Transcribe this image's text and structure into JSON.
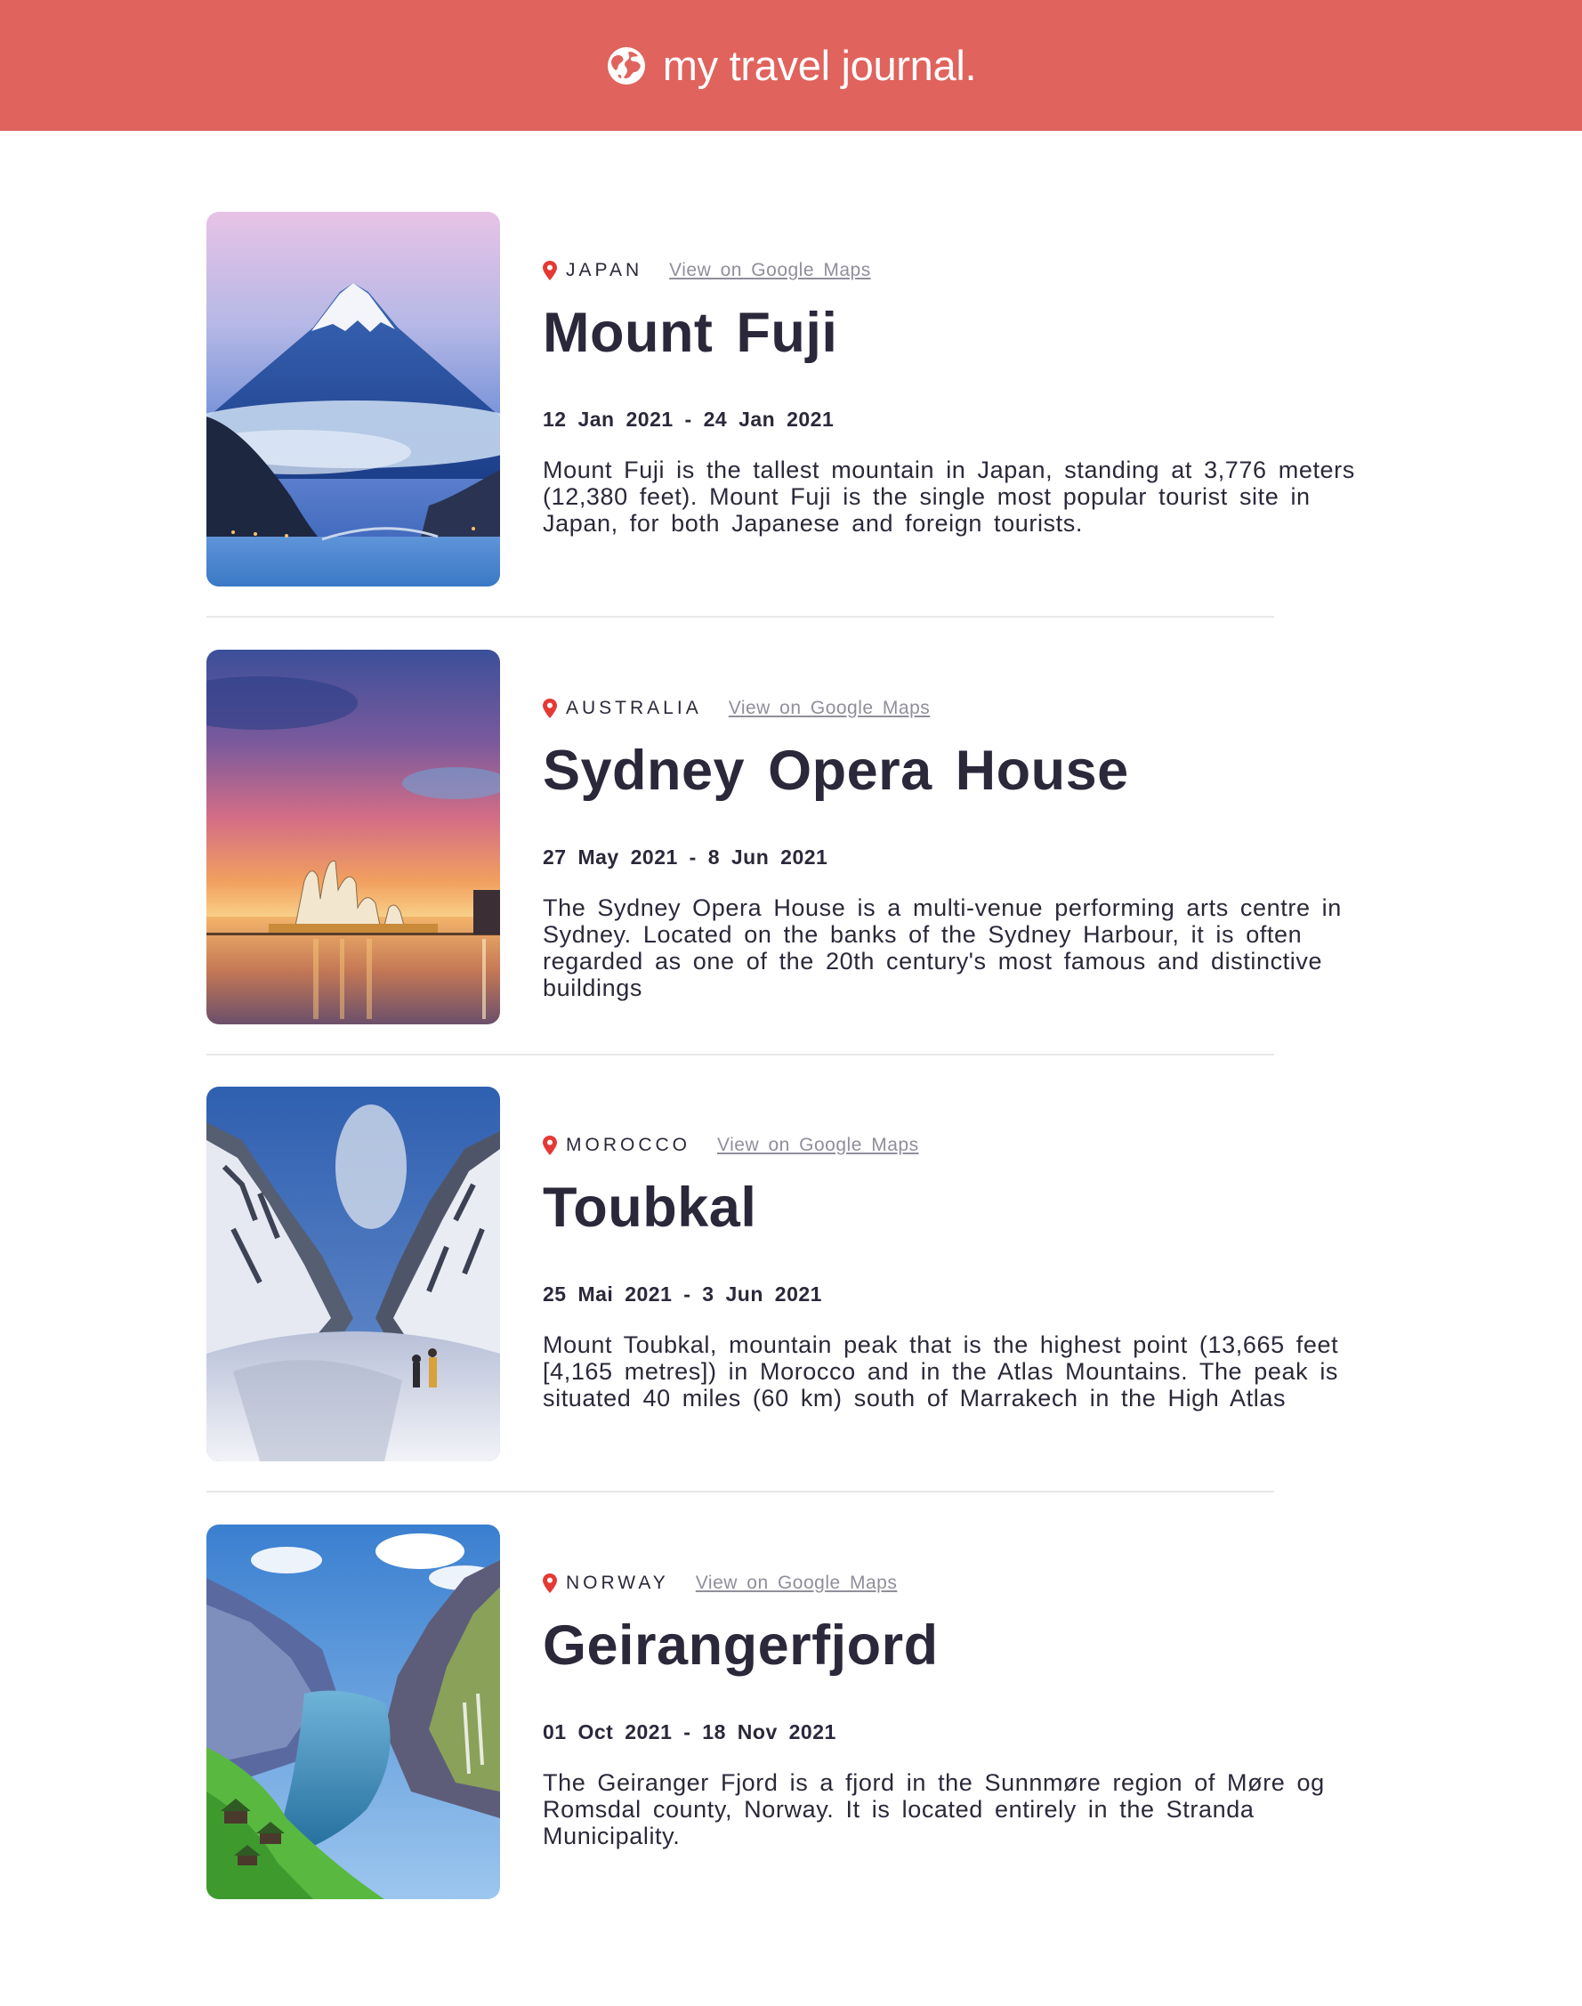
{
  "header": {
    "title": "my travel journal.",
    "icon": "globe-icon",
    "background": "#e0635d"
  },
  "entries": [
    {
      "country": "JAPAN",
      "maps_link": "View on Google Maps",
      "title": "Mount Fuji",
      "dates": "12 Jan 2021 - 24 Jan 2021",
      "description": "Mount Fuji is the tallest mountain in Japan, standing at 3,776 meters (12,380 feet). Mount Fuji is the single most popular tourist site in Japan, for both Japanese and foreign tourists."
    },
    {
      "country": "AUSTRALIA",
      "maps_link": "View on Google Maps",
      "title": "Sydney Opera House",
      "dates": "27 May 2021 - 8 Jun 2021",
      "description": "The Sydney Opera House is a multi-venue performing arts centre in Sydney. Located on the banks of the Sydney Harbour, it is often regarded as one of the 20th century's most famous and distinctive buildings"
    },
    {
      "country": "MOROCCO",
      "maps_link": "View on Google Maps",
      "title": "Toubkal",
      "dates": "25 Mai 2021 - 3 Jun 2021",
      "description": "Mount Toubkal, mountain peak that is the highest point (13,665 feet [4,165 metres]) in Morocco and in the Atlas Mountains. The peak is situated 40 miles (60 km) south of Marrakech in the High Atlas"
    },
    {
      "country": "NORWAY",
      "maps_link": "View on Google Maps",
      "title": "Geirangerfjord",
      "dates": "01 Oct 2021 - 18 Nov 2021",
      "description": "The Geiranger Fjord is a fjord in the Sunnmøre region of Møre og Romsdal county, Norway. It is located entirely in the Stranda Municipality."
    }
  ],
  "colors": {
    "accent": "#e0635d",
    "pin": "#e53935",
    "text": "#2b283a",
    "link": "#918e9b"
  }
}
